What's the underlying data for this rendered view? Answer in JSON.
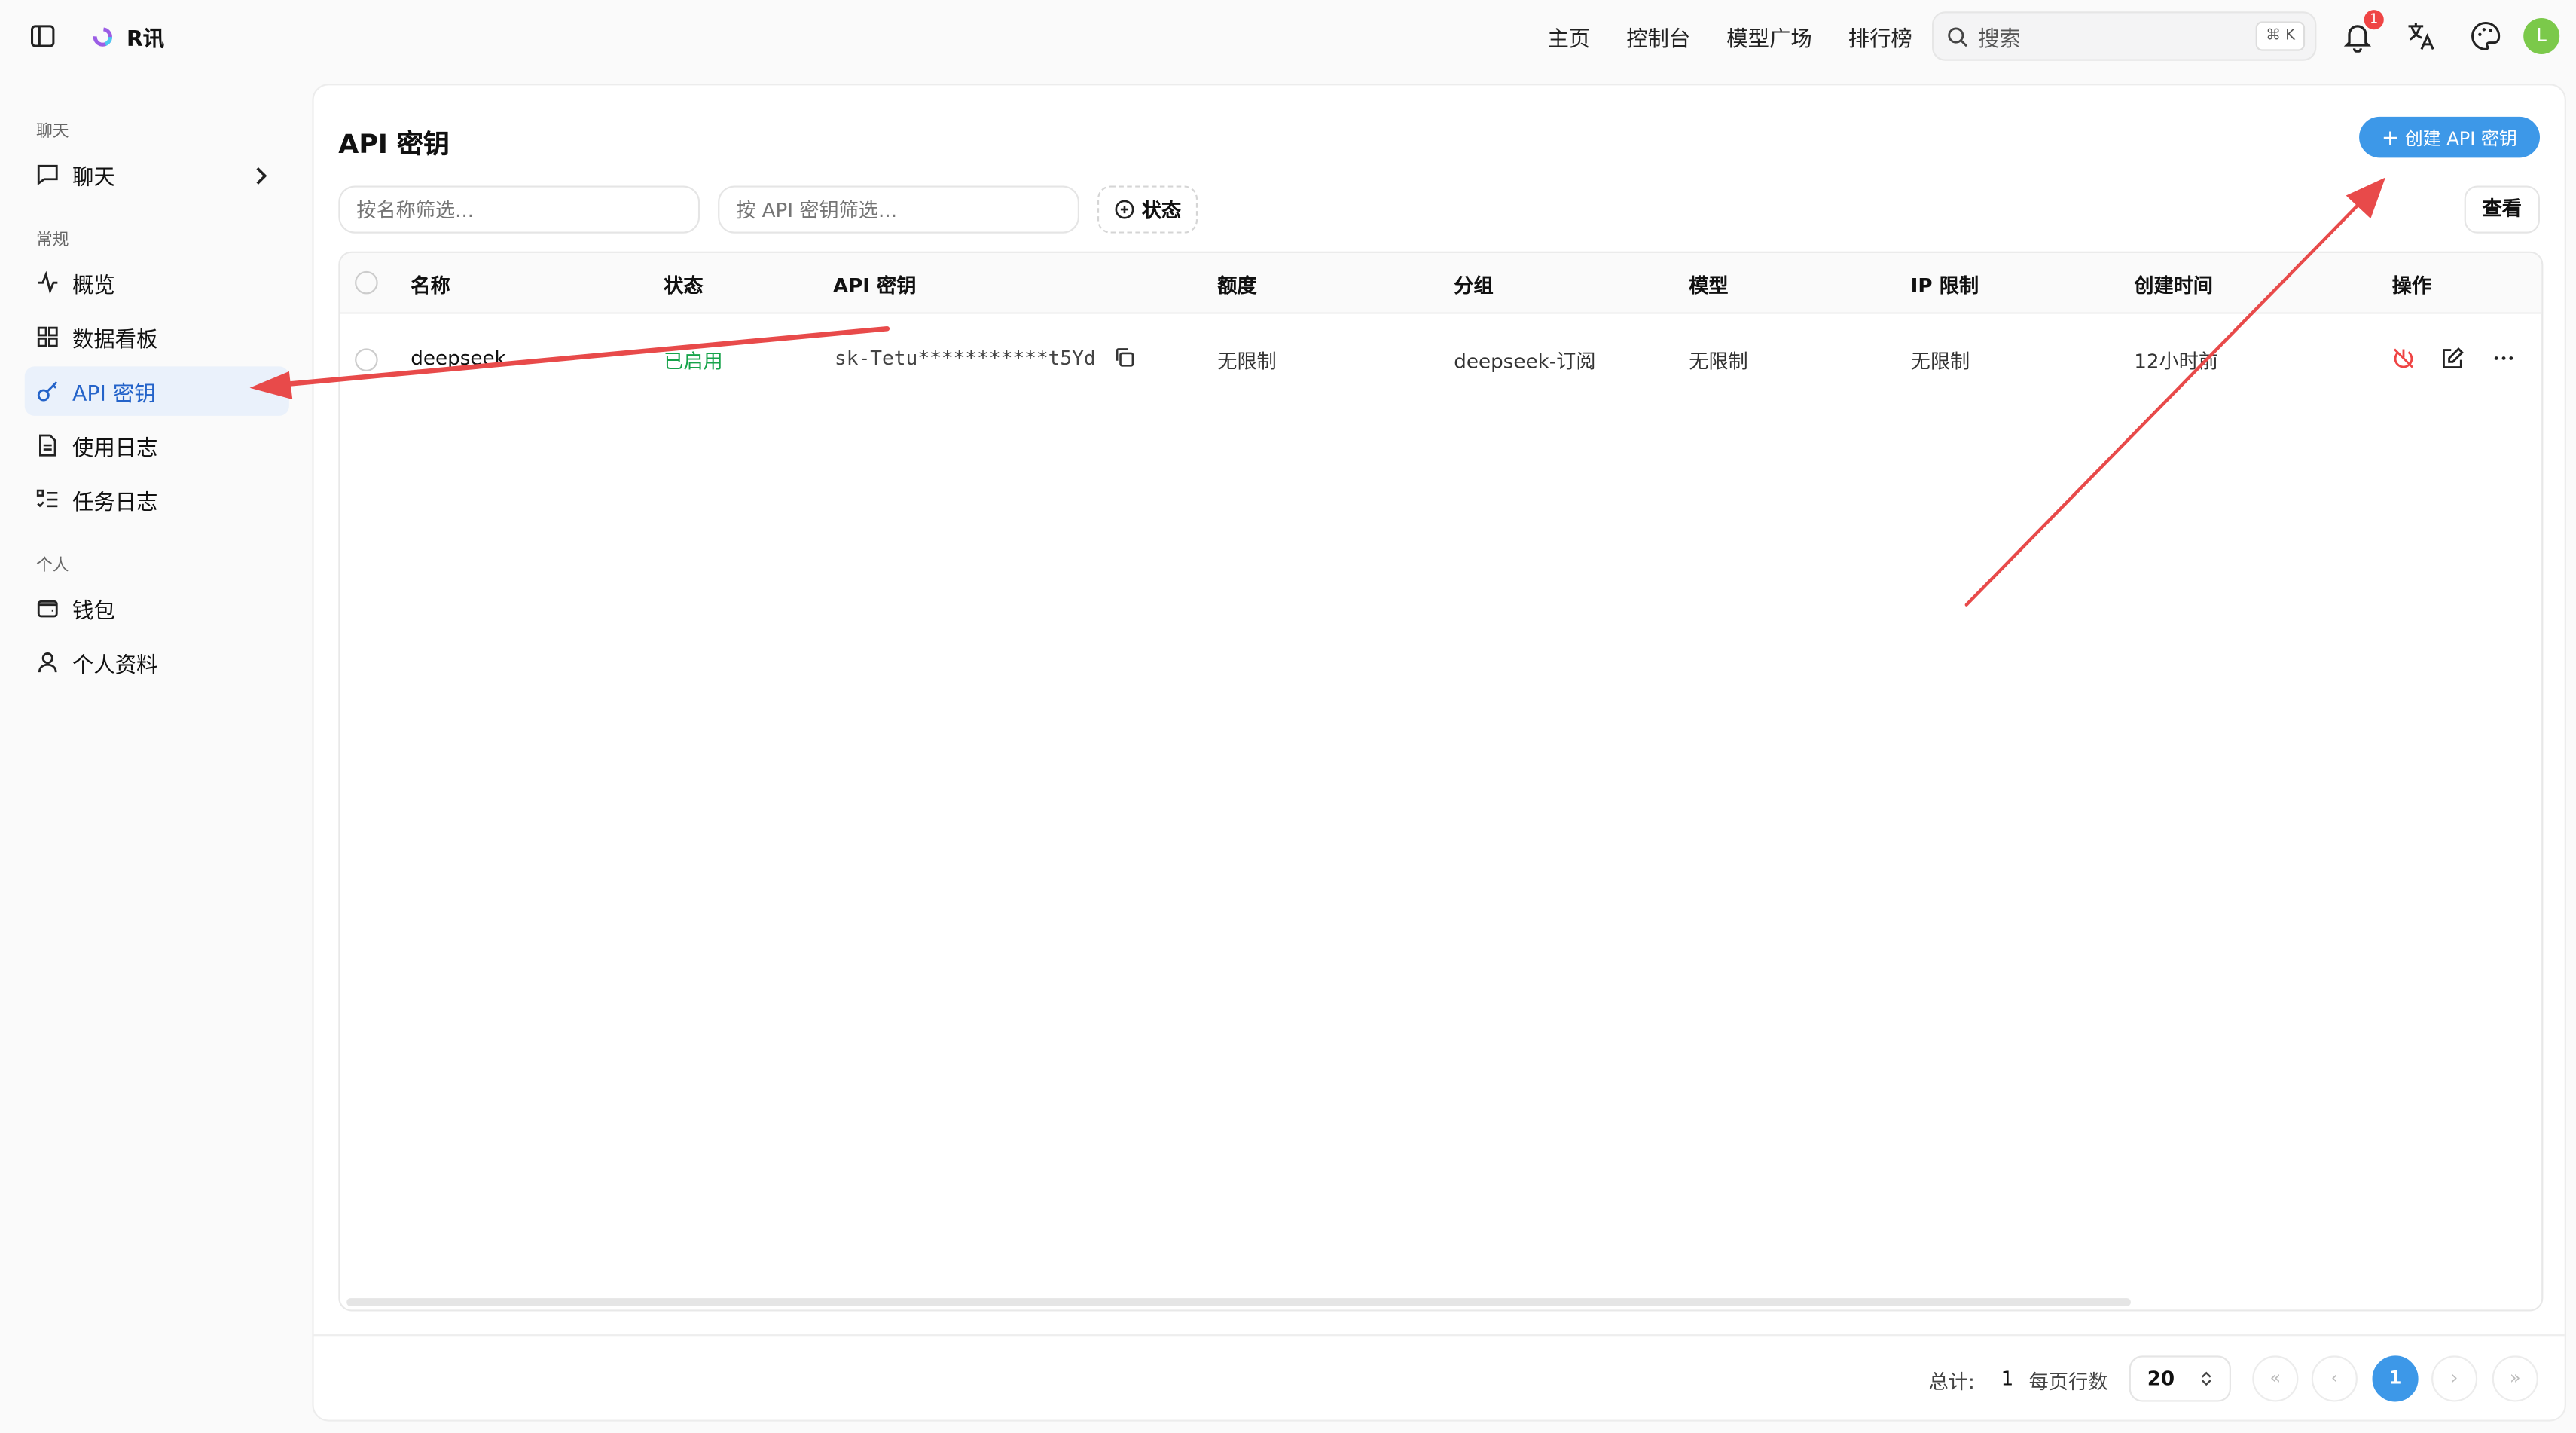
{
  "header": {
    "brand": "R讯",
    "nav": [
      "主页",
      "控制台",
      "模型广场",
      "排行榜"
    ],
    "search_placeholder": "搜索",
    "search_shortcut": "⌘ K",
    "notification_count": "1",
    "avatar_initial": "L"
  },
  "sidebar": {
    "sections": [
      {
        "title": "聊天",
        "items": [
          "聊天"
        ]
      },
      {
        "title": "常规",
        "items": [
          "概览",
          "数据看板",
          "API 密钥",
          "使用日志",
          "任务日志"
        ]
      },
      {
        "title": "个人",
        "items": [
          "钱包",
          "个人资料"
        ]
      }
    ],
    "active": "API 密钥"
  },
  "page": {
    "title": "API 密钥",
    "create_button": "创建 API 密钥",
    "filter_name_placeholder": "按名称筛选...",
    "filter_key_placeholder": "按 API 密钥筛选...",
    "status_filter": "状态",
    "view_button": "查看"
  },
  "table": {
    "columns": [
      "名称",
      "状态",
      "API 密钥",
      "额度",
      "分组",
      "模型",
      "IP 限制",
      "创建时间",
      "操作"
    ],
    "rows": [
      {
        "name": "deepseek",
        "status": "已启用",
        "key": "sk-Tetu***********t5Yd",
        "quota": "无限制",
        "group": "deepseek-订阅",
        "model": "无限制",
        "ip_limit": "无限制",
        "created": "12小时前"
      }
    ]
  },
  "pagination": {
    "total_label": "总计:",
    "total": "1",
    "rows_per_page_label": "每页行数",
    "rows_per_page": "20",
    "current_page": "1"
  },
  "colors": {
    "accent": "#3d98e8",
    "success": "#16a34a",
    "danger": "#ef4444",
    "arrow": "#e84a4a"
  }
}
